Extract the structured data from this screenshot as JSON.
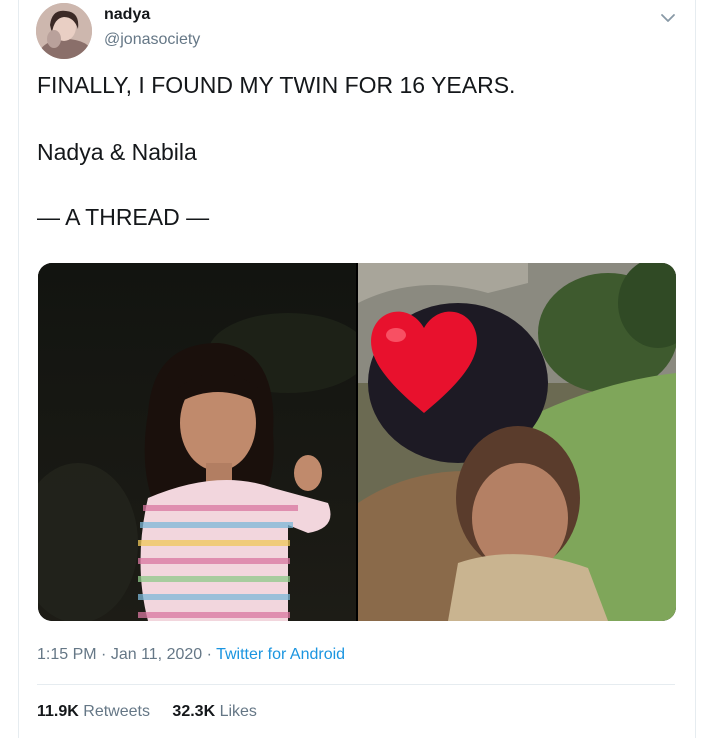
{
  "user": {
    "display_name": "nadya",
    "handle": "@jonasociety",
    "avatar_icon": "profile-photo"
  },
  "menu_icon": "chevron-down-icon",
  "tweet": {
    "line1": "FINALLY, I FOUND MY TWIN FOR 16 YEARS.",
    "line2": "Nadya & Nabila",
    "line3": "— A THREAD —"
  },
  "media": {
    "photos": [
      "girl-striped-shirt-photo",
      "child-with-heart-covered-face-photo"
    ],
    "overlay_icon": "red-heart-emoji"
  },
  "meta": {
    "time": "1:15 PM",
    "sep1": "·",
    "date": "Jan 11, 2020",
    "sep2": "·",
    "source": "Twitter for Android"
  },
  "stats": {
    "retweets_count": "11.9K",
    "retweets_label": "Retweets",
    "likes_count": "32.3K",
    "likes_label": "Likes"
  },
  "colors": {
    "text": "#14171a",
    "secondary": "#657786",
    "link": "#1b95e0",
    "border": "#e6ecf0",
    "heart": "#e8112d"
  }
}
